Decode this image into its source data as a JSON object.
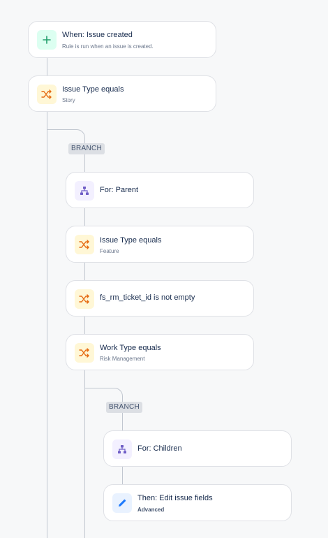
{
  "trigger": {
    "title": "When: Issue created",
    "subtitle": "Rule is run when an issue is created.",
    "icon": "plus-icon"
  },
  "condition_issue_type_story": {
    "title": "Issue Type equals",
    "subtitle": "Story",
    "icon": "shuffle-icon"
  },
  "branch_1": {
    "label": "BRANCH"
  },
  "for_parent": {
    "title": "For: Parent",
    "icon": "hierarchy-icon"
  },
  "condition_issue_type_feature": {
    "title": "Issue Type equals",
    "subtitle": "Feature",
    "icon": "shuffle-icon"
  },
  "condition_fs_rm": {
    "title": "fs_rm_ticket_id is not empty",
    "icon": "shuffle-icon"
  },
  "condition_work_type": {
    "title": "Work Type equals",
    "subtitle": "Risk Management",
    "icon": "shuffle-icon"
  },
  "branch_2": {
    "label": "BRANCH"
  },
  "for_children": {
    "title": "For: Children",
    "icon": "hierarchy-icon"
  },
  "action_edit": {
    "title": "Then: Edit issue fields",
    "subtitle": "Advanced",
    "icon": "pencil-icon"
  },
  "colors": {
    "trigger_icon": "#22a06b",
    "condition_icon": "#e56910",
    "branch_icon": "#6e5dc6",
    "action_icon": "#1d7afc",
    "connector": "#c1c7d0"
  }
}
